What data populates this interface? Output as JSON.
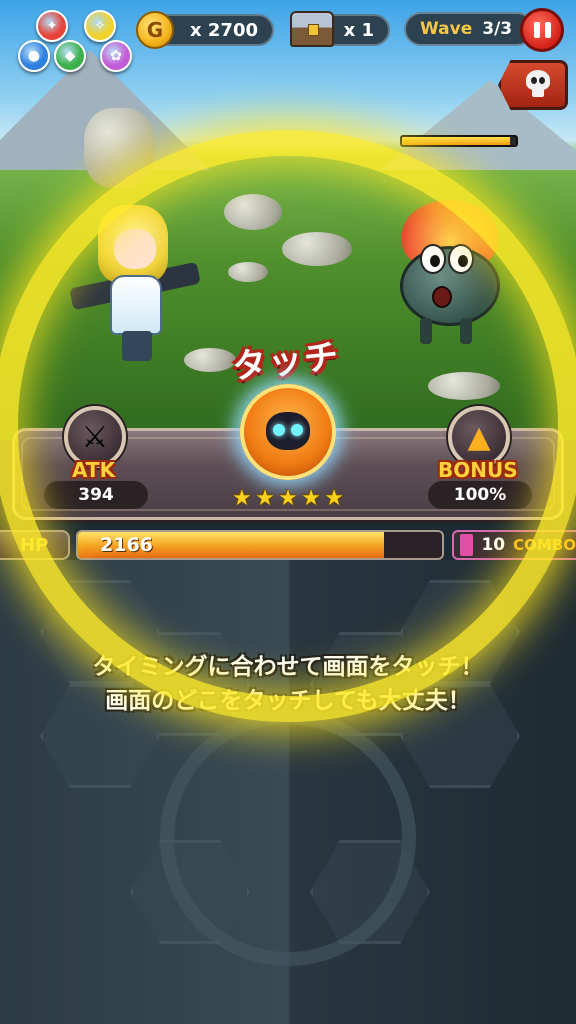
{
  "hud": {
    "elements": [
      {
        "icon": "fire-element-icon",
        "color": "#e8443a"
      },
      {
        "icon": "light-element-icon",
        "color": "#f0d22a"
      },
      {
        "icon": "water-element-icon",
        "color": "#2f7fe0"
      },
      {
        "icon": "wind-element-icon",
        "color": "#3cb04a"
      },
      {
        "icon": "dark-element-icon",
        "color": "#c45bd6"
      }
    ],
    "gold": "x 2700",
    "chests": "x 1",
    "wave_label": "Wave",
    "wave_value": "3/3",
    "coin_symbol": "G"
  },
  "enemy": {
    "hp_fraction": 0.95
  },
  "skill": {
    "touch_text": "タッチ",
    "stars": [
      "★",
      "★",
      "★",
      "★",
      "★"
    ],
    "atk_label": "ATK",
    "atk_value": "394",
    "bonus_label": "BONUS",
    "bonus_value": "100%"
  },
  "party": {
    "hp_label": "HP",
    "hp_value": "2166",
    "hp_fraction": 0.84,
    "combo_value": "10",
    "combo_label": "COMBO"
  },
  "instruction": {
    "line1": "タイミングに合わせて画面をタッチ！",
    "line2": "画面のどこをタッチしても大丈夫！"
  },
  "colors": {
    "glow": "#ffe628",
    "accent": "#ffd13b",
    "pause": "#d4221a"
  }
}
